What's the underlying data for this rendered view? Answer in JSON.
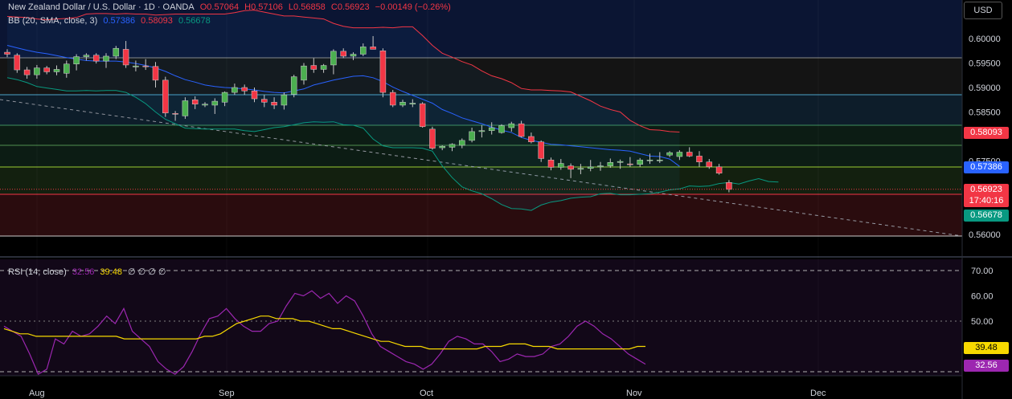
{
  "header": {
    "symbol_line": "New Zealand Dollar / U.S. Dollar · 1D · OANDA",
    "ohlc": {
      "o": "O0.57064",
      "h": "H0.57106",
      "l": "L0.56858",
      "c": "C0.56923",
      "chg": "−0.00149 (−0.26%)"
    },
    "bb_title": "BB (20, SMA, close, 3)",
    "bb_values": {
      "basis": "0.57386",
      "upper": "0.58093",
      "lower": "0.56678"
    },
    "rsi_title": "RSI (14, close)",
    "rsi_values": {
      "rsi": "32.56",
      "ma": "39.48",
      "rest": "∅ ∅ ∅ ∅"
    }
  },
  "currency_button": "USD",
  "price_labels": {
    "upper": "0.58093",
    "basis": "0.57386",
    "last": "0.56923",
    "countdown": "17:40:16",
    "lower": "0.56678",
    "rsi_ma": "39.48",
    "rsi": "32.56"
  },
  "colors": {
    "up": "#26a69a",
    "up_body": "#4caf50",
    "down": "#f23645",
    "upper_band": "#f23645",
    "basis": "#2962ff",
    "lower_band": "#089981",
    "rsi": "#9c27b0",
    "rsi_ma": "#f7d900"
  },
  "chart_data": [
    {
      "type": "candlestick",
      "title": "New Zealand Dollar / U.S. Dollar · 1D · OANDA",
      "y_ticks": [
        "0.60000",
        "0.59500",
        "0.59000",
        "0.58500",
        "0.57500",
        "0.56000"
      ],
      "ylim": [
        0.5583,
        0.6025
      ],
      "x_ticks": [
        "Aug",
        "Sep",
        "Oct",
        "Nov",
        "Dec"
      ],
      "ohlc": [
        [
          0.5972,
          0.5978,
          0.5962,
          0.5968
        ],
        [
          0.5966,
          0.597,
          0.593,
          0.5936
        ],
        [
          0.5936,
          0.5942,
          0.5918,
          0.5926
        ],
        [
          0.5926,
          0.5946,
          0.5918,
          0.594
        ],
        [
          0.594,
          0.5944,
          0.5927,
          0.5932
        ],
        [
          0.5932,
          0.5945,
          0.5925,
          0.5937
        ],
        [
          0.5929,
          0.5955,
          0.592,
          0.5948
        ],
        [
          0.5948,
          0.5968,
          0.5935,
          0.5963
        ],
        [
          0.5963,
          0.597,
          0.5955,
          0.5966
        ],
        [
          0.5966,
          0.597,
          0.5949,
          0.5954
        ],
        [
          0.5954,
          0.597,
          0.594,
          0.5964
        ],
        [
          0.5964,
          0.5985,
          0.5958,
          0.598
        ],
        [
          0.5978,
          0.5995,
          0.594,
          0.5946
        ],
        [
          0.5942,
          0.5955,
          0.5933,
          0.5944
        ],
        [
          0.5944,
          0.5958,
          0.5936,
          0.5943
        ],
        [
          0.5943,
          0.5952,
          0.59,
          0.5915
        ],
        [
          0.5915,
          0.5922,
          0.584,
          0.5848
        ],
        [
          0.5847,
          0.5852,
          0.5832,
          0.5846
        ],
        [
          0.5842,
          0.588,
          0.5836,
          0.5873
        ],
        [
          0.5875,
          0.5882,
          0.5856,
          0.5866
        ],
        [
          0.5864,
          0.587,
          0.586,
          0.5866
        ],
        [
          0.5864,
          0.5878,
          0.5846,
          0.5872
        ],
        [
          0.587,
          0.5892,
          0.5862,
          0.589
        ],
        [
          0.589,
          0.5908,
          0.5885,
          0.59
        ],
        [
          0.59,
          0.5906,
          0.5885,
          0.5893
        ],
        [
          0.5893,
          0.59,
          0.587,
          0.5877
        ],
        [
          0.5876,
          0.5885,
          0.586,
          0.587
        ],
        [
          0.587,
          0.588,
          0.5856,
          0.5864
        ],
        [
          0.5864,
          0.589,
          0.5855,
          0.5885
        ],
        [
          0.5886,
          0.5926,
          0.588,
          0.5922
        ],
        [
          0.5915,
          0.595,
          0.5906,
          0.5944
        ],
        [
          0.5945,
          0.596,
          0.593,
          0.5937
        ],
        [
          0.5937,
          0.5948,
          0.593,
          0.5945
        ],
        [
          0.5946,
          0.5978,
          0.5927,
          0.5974
        ],
        [
          0.5974,
          0.598,
          0.596,
          0.5964
        ],
        [
          0.5964,
          0.5972,
          0.5956,
          0.5968
        ],
        [
          0.5968,
          0.599,
          0.5964,
          0.5983
        ],
        [
          0.5983,
          0.6005,
          0.5978,
          0.5978
        ],
        [
          0.5975,
          0.598,
          0.588,
          0.589
        ],
        [
          0.589,
          0.5895,
          0.586,
          0.5864
        ],
        [
          0.5864,
          0.5875,
          0.586,
          0.587
        ],
        [
          0.5866,
          0.5876,
          0.586,
          0.5868
        ],
        [
          0.5867,
          0.587,
          0.5818,
          0.582
        ],
        [
          0.5815,
          0.582,
          0.5773,
          0.5776
        ],
        [
          0.5777,
          0.5782,
          0.5772,
          0.578
        ],
        [
          0.5778,
          0.5786,
          0.577,
          0.5784
        ],
        [
          0.5782,
          0.5796,
          0.5776,
          0.5792
        ],
        [
          0.5792,
          0.5818,
          0.5788,
          0.581
        ],
        [
          0.581,
          0.5823,
          0.5798,
          0.5812
        ],
        [
          0.5812,
          0.5829,
          0.5804,
          0.5818
        ],
        [
          0.5808,
          0.5825,
          0.5806,
          0.5822
        ],
        [
          0.5818,
          0.583,
          0.581,
          0.5826
        ],
        [
          0.5826,
          0.5832,
          0.5798,
          0.58
        ],
        [
          0.58,
          0.5808,
          0.5786,
          0.5789
        ],
        [
          0.5789,
          0.5792,
          0.5748,
          0.5755
        ],
        [
          0.5752,
          0.5757,
          0.5731,
          0.5737
        ],
        [
          0.5737,
          0.5754,
          0.5732,
          0.5745
        ],
        [
          0.574,
          0.5745,
          0.5715,
          0.5733
        ],
        [
          0.5733,
          0.5744,
          0.5723,
          0.5735
        ],
        [
          0.5735,
          0.5752,
          0.5729,
          0.5738
        ],
        [
          0.5738,
          0.5748,
          0.573,
          0.574
        ],
        [
          0.574,
          0.5755,
          0.5736,
          0.5747
        ],
        [
          0.5747,
          0.5753,
          0.5734,
          0.5749
        ],
        [
          0.5744,
          0.5758,
          0.5738,
          0.5743
        ],
        [
          0.5743,
          0.5756,
          0.5738,
          0.5752
        ],
        [
          0.5752,
          0.5765,
          0.5744,
          0.5752
        ],
        [
          0.5752,
          0.5768,
          0.5746,
          0.5752
        ],
        [
          0.5762,
          0.577,
          0.5758,
          0.5767
        ],
        [
          0.5759,
          0.5772,
          0.5752,
          0.5768
        ],
        [
          0.5768,
          0.5778,
          0.5758,
          0.576
        ],
        [
          0.576,
          0.577,
          0.5738,
          0.5748
        ],
        [
          0.5748,
          0.5754,
          0.5734,
          0.5738
        ],
        [
          0.5738,
          0.5744,
          0.5722,
          0.5725
        ],
        [
          0.5706,
          0.5711,
          0.5686,
          0.5692
        ]
      ],
      "bb_upper": [
        0.6045,
        0.6044,
        0.6043,
        0.604,
        0.6038,
        0.604,
        0.6041,
        0.6043,
        0.605,
        0.6051,
        0.6051,
        0.605,
        0.6051,
        0.605,
        0.605,
        0.6048,
        0.6049,
        0.605,
        0.605,
        0.605,
        0.605,
        0.605,
        0.605,
        0.6053,
        0.6057,
        0.6058,
        0.6054,
        0.605,
        0.6046,
        0.6046,
        0.6044,
        0.6042,
        0.604,
        0.6031,
        0.6025,
        0.6022,
        0.6022,
        0.6022,
        0.6023,
        0.6022,
        0.6024,
        0.6024,
        0.6006,
        0.5986,
        0.597,
        0.5962,
        0.5953,
        0.5946,
        0.5934,
        0.5924,
        0.5918,
        0.591,
        0.5898,
        0.5895,
        0.5895,
        0.5894,
        0.5893,
        0.5891,
        0.5882,
        0.5873,
        0.5862,
        0.5855,
        0.585,
        0.5833,
        0.5822,
        0.5814,
        0.5813,
        0.581,
        0.5809
      ],
      "bb_basis": [
        0.5986,
        0.5981,
        0.5976,
        0.5972,
        0.5969,
        0.5965,
        0.5961,
        0.5958,
        0.5955,
        0.5954,
        0.5954,
        0.5954,
        0.5952,
        0.5949,
        0.5945,
        0.594,
        0.5933,
        0.5924,
        0.5916,
        0.5911,
        0.5905,
        0.5902,
        0.59,
        0.5899,
        0.5897,
        0.5895,
        0.5892,
        0.589,
        0.5889,
        0.5893,
        0.5897,
        0.5905,
        0.591,
        0.5915,
        0.5919,
        0.5923,
        0.5924,
        0.592,
        0.5912,
        0.5901,
        0.5892,
        0.5884,
        0.5876,
        0.5868,
        0.5855,
        0.5847,
        0.5838,
        0.5832,
        0.5826,
        0.5819,
        0.5813,
        0.5808,
        0.5798,
        0.5792,
        0.5788,
        0.5784,
        0.5783,
        0.5781,
        0.5779,
        0.5777,
        0.5775,
        0.5773,
        0.5772,
        0.577,
        0.5765,
        0.576,
        0.5759,
        0.5754,
        0.5739
      ],
      "bb_lower": [
        0.592,
        0.5916,
        0.591,
        0.5902,
        0.5899,
        0.5896,
        0.5893,
        0.5893,
        0.5894,
        0.5893,
        0.5894,
        0.5894,
        0.589,
        0.588,
        0.5867,
        0.585,
        0.5835,
        0.5826,
        0.5817,
        0.5816,
        0.5815,
        0.5815,
        0.5815,
        0.5815,
        0.5812,
        0.581,
        0.5814,
        0.5818,
        0.582,
        0.5824,
        0.5828,
        0.583,
        0.5829,
        0.583,
        0.5824,
        0.5823,
        0.5817,
        0.5795,
        0.5781,
        0.5777,
        0.5777,
        0.5777,
        0.5776,
        0.577,
        0.574,
        0.5716,
        0.5697,
        0.5689,
        0.5683,
        0.5673,
        0.5661,
        0.5653,
        0.5652,
        0.5649,
        0.566,
        0.5666,
        0.5669,
        0.5674,
        0.5676,
        0.5677,
        0.5683,
        0.5684,
        0.5681,
        0.5681,
        0.5682,
        0.5683,
        0.5686,
        0.5691,
        0.5693,
        0.5699,
        0.5698,
        0.5699,
        0.5704,
        0.5706,
        0.5703,
        0.5709,
        0.5714,
        0.5708,
        0.5707
      ]
    },
    {
      "type": "line",
      "title": "RSI (14, close)",
      "y_ticks": [
        "70.00",
        "60.00",
        "50.00"
      ],
      "ylim": [
        30,
        70
      ],
      "series": [
        {
          "name": "RSI",
          "values": [
            48,
            46,
            44,
            37,
            29,
            31,
            43,
            41,
            46,
            44,
            45,
            48,
            52,
            49,
            55,
            46,
            43,
            40,
            34,
            31,
            29,
            32,
            38,
            45,
            51,
            52,
            55,
            51,
            48,
            46,
            46,
            49,
            50,
            56,
            61,
            60,
            62,
            59,
            61,
            57,
            60,
            58,
            52,
            45,
            40,
            38,
            36,
            34,
            33,
            31,
            33,
            37,
            42,
            44,
            43,
            41,
            41,
            38,
            34,
            35,
            37,
            36,
            36,
            37,
            40,
            41,
            44,
            48,
            50,
            48,
            45,
            43,
            40,
            37,
            35,
            33
          ]
        },
        {
          "name": "RSI MA",
          "values": [
            47,
            46,
            45,
            45,
            44,
            44,
            44,
            44,
            44,
            44,
            44,
            44,
            44,
            44,
            44,
            43,
            43,
            43,
            43,
            43,
            43,
            43,
            43,
            43,
            43,
            44,
            44,
            45,
            47,
            49,
            50,
            51,
            52,
            52,
            51,
            51,
            51,
            50,
            50,
            49,
            48,
            47,
            47,
            46,
            45,
            44,
            43,
            42,
            42,
            41,
            40,
            40,
            40,
            39,
            39,
            39,
            39,
            39,
            39,
            39,
            40,
            40,
            40,
            41,
            41,
            41,
            40,
            40,
            40,
            39,
            39,
            39,
            39,
            39,
            39,
            39,
            39,
            39,
            39,
            40,
            40
          ]
        }
      ]
    }
  ]
}
